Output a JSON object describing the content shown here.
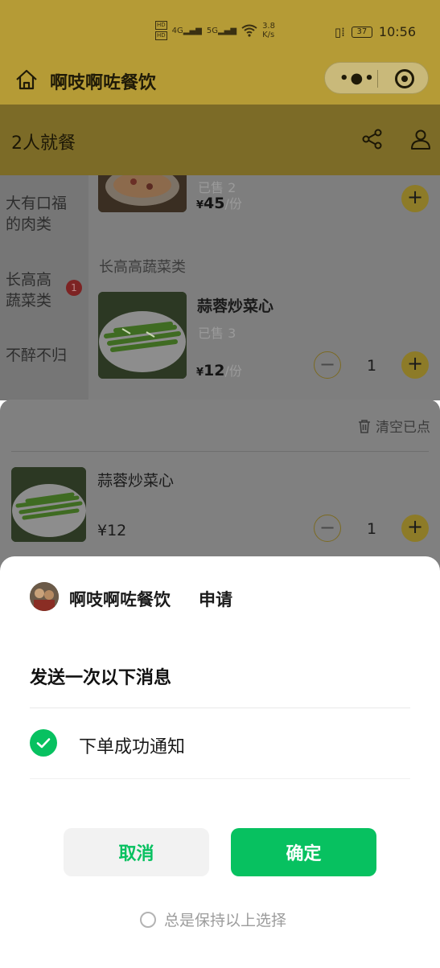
{
  "status_bar": {
    "network": "4G",
    "network2": "5G",
    "speed_value": "3.8",
    "speed_unit": "K/s",
    "battery": "37",
    "time": "10:56"
  },
  "header": {
    "title": "啊吱啊咗餐饮"
  },
  "sub_header": {
    "title": "2人就餐"
  },
  "menu": {
    "categories": [
      {
        "label_line1": "大有口福",
        "label_line2": "的肉类"
      },
      {
        "label_line1": "长高高",
        "label_line2": "蔬菜类",
        "badge": "1"
      },
      {
        "label_line1": "不醉不归",
        "label_line2": ""
      }
    ],
    "top_dish": {
      "sold": "已售 2",
      "currency": "¥",
      "price": "45",
      "unit": "/份"
    },
    "section_title": "长高高蔬菜类",
    "dish": {
      "name": "蒜蓉炒菜心",
      "sold": "已售 3",
      "currency": "¥",
      "price": "12",
      "unit": "/份",
      "quantity": "1"
    }
  },
  "cart": {
    "clear_label": "清空已点",
    "item": {
      "name": "蒜蓉炒菜心",
      "price": "¥12",
      "quantity": "1"
    }
  },
  "dialog": {
    "app_name": "啊吱啊咗餐饮",
    "request_label": "申请",
    "title": "发送一次以下消息",
    "option_label": "下单成功通知",
    "cancel_label": "取消",
    "confirm_label": "确定",
    "keep_choice_label": "总是保持以上选择",
    "accent_color": "#07c160"
  }
}
